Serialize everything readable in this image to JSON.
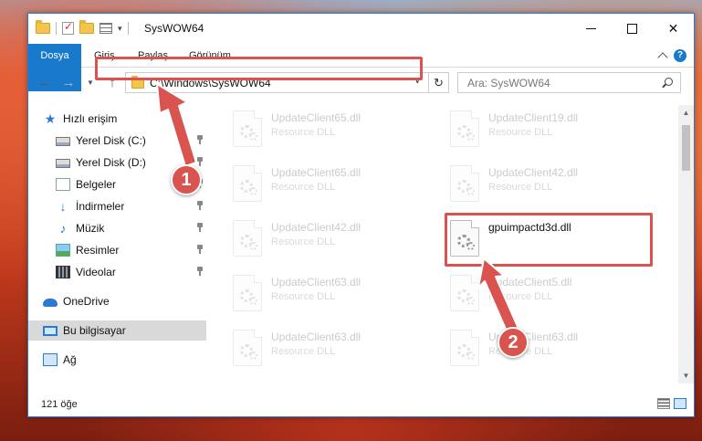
{
  "window": {
    "title": "SysWOW64",
    "controls": {
      "minimize": "—",
      "maximize": "",
      "close": "✕"
    }
  },
  "ribbon": {
    "tabs": [
      {
        "label": "Dosya"
      },
      {
        "label": "Giriş"
      },
      {
        "label": "Paylaş"
      },
      {
        "label": "Görünüm"
      }
    ],
    "help": "?"
  },
  "nav": {
    "back": "←",
    "forward": "→",
    "recent": "▼",
    "up": "↑",
    "address": "C:\\Windows\\SysWOW64",
    "address_drop": "∨",
    "refresh": "↻",
    "search_placeholder": "Ara: SysWOW64"
  },
  "sidebar": {
    "items": [
      {
        "label": "Hızlı erişim",
        "icon": "star-icon"
      },
      {
        "label": "Yerel Disk (C:)",
        "icon": "disk-icon",
        "pinned": true
      },
      {
        "label": "Yerel Disk (D:)",
        "icon": "disk-icon",
        "pinned": true
      },
      {
        "label": "Belgeler",
        "icon": "document-icon",
        "pinned": true
      },
      {
        "label": "İndirmeler",
        "icon": "download-icon",
        "pinned": true
      },
      {
        "label": "Müzik",
        "icon": "music-icon",
        "pinned": true
      },
      {
        "label": "Resimler",
        "icon": "pictures-icon",
        "pinned": true
      },
      {
        "label": "Videolar",
        "icon": "video-icon",
        "pinned": true
      },
      {
        "label": "OneDrive",
        "icon": "cloud-icon"
      },
      {
        "label": "Bu bilgisayar",
        "icon": "computer-icon",
        "selected": true
      },
      {
        "label": "Ağ",
        "icon": "network-icon"
      }
    ]
  },
  "files": [
    {
      "name": "UpdateClient65.dll",
      "type": "Resource DLL",
      "faded": true
    },
    {
      "name": "UpdateClient19.dll",
      "type": "Resource DLL",
      "faded": true
    },
    {
      "name": "UpdateClient65.dll",
      "type": "Resource DLL",
      "faded": true
    },
    {
      "name": "UpdateClient42.dll",
      "type": "Resource DLL",
      "faded": true
    },
    {
      "name": "UpdateClient42.dll",
      "type": "Resource DLL",
      "faded": true
    },
    {
      "name": "gpuimpactd3d.dll",
      "type": "",
      "faded": false
    },
    {
      "name": "UpdateClient63.dll",
      "type": "Resource DLL",
      "faded": true
    },
    {
      "name": "UpdateClient5.dll",
      "type": "Resource DLL",
      "faded": true
    },
    {
      "name": "UpdateClient63.dll",
      "type": "Resource DLL",
      "faded": true
    },
    {
      "name": "UpdateClient63.dll",
      "type": "Resource DLL",
      "faded": true
    }
  ],
  "status": {
    "item_count": "121 öğe"
  },
  "annotations": {
    "badge1": "1",
    "badge2": "2",
    "color": "#d9534f"
  },
  "colors": {
    "accent": "#1979ca",
    "highlight": "#d9534f",
    "selection": "#d9d9d9"
  }
}
